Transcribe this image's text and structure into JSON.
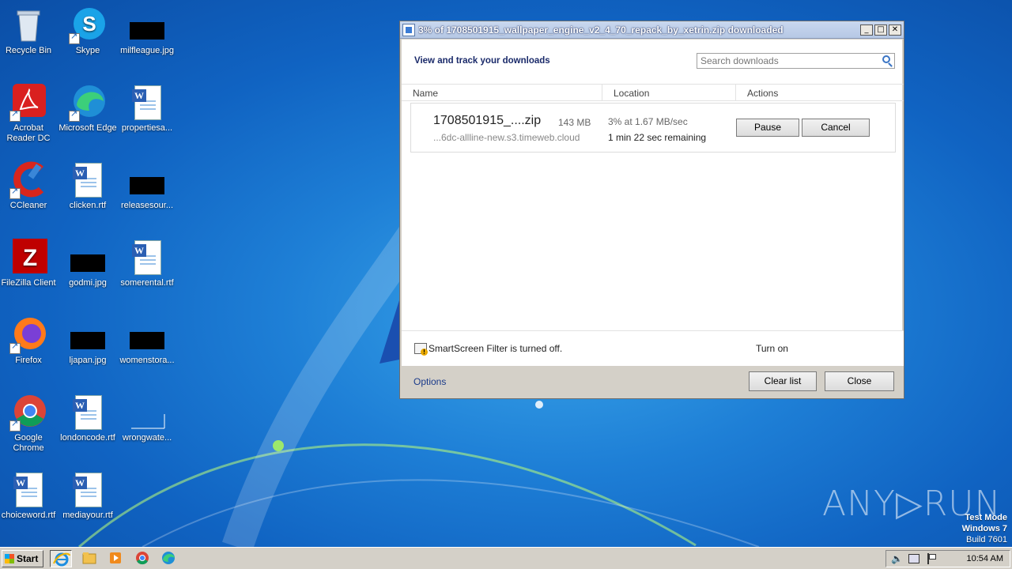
{
  "desktop": {
    "icons": [
      {
        "label": "Recycle Bin"
      },
      {
        "label": "Skype"
      },
      {
        "label": "milfleague.jpg"
      },
      {
        "label": "Acrobat Reader DC"
      },
      {
        "label": "Microsoft Edge"
      },
      {
        "label": "propertiesa..."
      },
      {
        "label": "CCleaner"
      },
      {
        "label": "clicken.rtf"
      },
      {
        "label": "releasesour..."
      },
      {
        "label": "FileZilla Client"
      },
      {
        "label": "godmi.jpg"
      },
      {
        "label": "somerental.rtf"
      },
      {
        "label": "Firefox"
      },
      {
        "label": "ljapan.jpg"
      },
      {
        "label": "womenstora..."
      },
      {
        "label": "Google Chrome"
      },
      {
        "label": "londoncode.rtf"
      },
      {
        "label": "wrongwate..."
      },
      {
        "label": "choiceword.rtf"
      },
      {
        "label": "mediayour.rtf"
      }
    ]
  },
  "download_window": {
    "title": "3% of 1708501915_wallpaper_engine_v2_4_70_repack_by_xetrin.zip downloaded",
    "controls": {
      "minimize": "_",
      "maximize": "□",
      "close": "✕"
    },
    "header": "View and track your downloads",
    "search_placeholder": "Search downloads",
    "columns": {
      "name": "Name",
      "location": "Location",
      "actions": "Actions"
    },
    "item": {
      "filename": "1708501915_....zip",
      "size": "143 MB",
      "source": "...6dc-allline-new.s3.timeweb.cloud",
      "progress": "3% at 1.67 MB/sec",
      "remaining": "1 min 22 sec remaining",
      "pause_label": "Pause",
      "cancel_label": "Cancel"
    },
    "smartscreen": {
      "text": "SmartScreen Filter is turned off.",
      "action": "Turn on"
    },
    "footer": {
      "options": "Options",
      "clear_list": "Clear list",
      "close": "Close"
    }
  },
  "watermark": {
    "text": "ANY▷RUN"
  },
  "os_info": {
    "line1": "Test Mode",
    "line2": "Windows 7",
    "line3": "Build 7601"
  },
  "taskbar": {
    "start_label": "Start",
    "clock": "10:54 AM"
  }
}
